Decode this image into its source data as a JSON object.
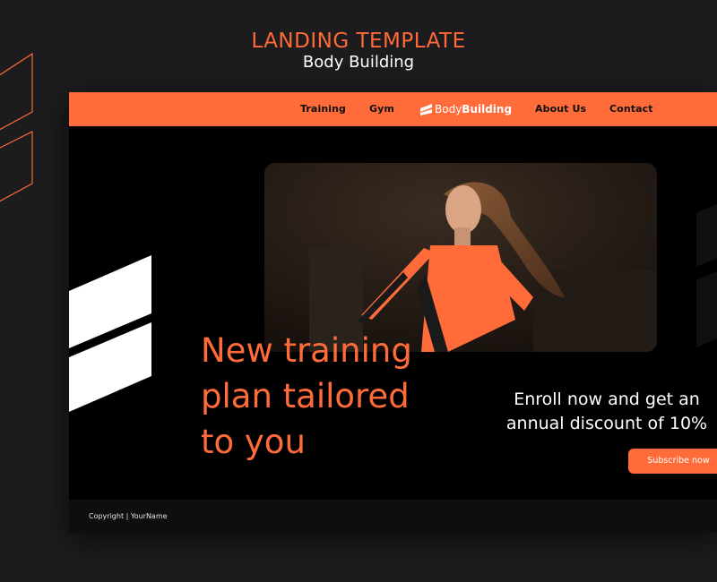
{
  "presentation": {
    "title": "LANDING TEMPLATE",
    "subtitle": "Body Building"
  },
  "navbar": {
    "items": [
      "Training",
      "Gym",
      "About Us",
      "Contact"
    ],
    "logo": {
      "light": "Body",
      "bold": "Building"
    }
  },
  "hero": {
    "headline_lines": [
      "New training",
      "plan tailored",
      "to you"
    ],
    "enroll_lines": [
      "Enroll now and get an",
      "annual discount of 10%"
    ],
    "subscribe_label": "Subscribe now"
  },
  "footer": {
    "copyright": "Copyright | YourName"
  },
  "colors": {
    "accent": "#ff6c3a",
    "background": "#1c1c1e",
    "page": "#000000",
    "text": "#ffffff"
  },
  "icons": [
    "logo-stripes-icon",
    "decorative-stripes"
  ]
}
